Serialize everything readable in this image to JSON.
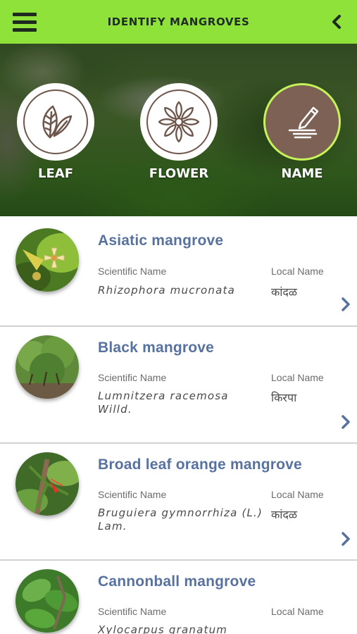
{
  "header": {
    "title": "IDENTIFY MANGROVES",
    "menu_icon": "hamburger-menu-icon",
    "back_icon": "chevron-left-icon",
    "bar_color": "#8ee23a"
  },
  "categories": [
    {
      "label": "LEAF",
      "icon": "leaf-icon",
      "active": false
    },
    {
      "label": "FLOWER",
      "icon": "flower-icon",
      "active": false
    },
    {
      "label": "NAME",
      "icon": "pencil-write-icon",
      "active": true
    }
  ],
  "list": {
    "scientific_label": "Scientific Name",
    "local_label": "Local Name",
    "items": [
      {
        "common_name": "Asiatic mangrove",
        "scientific_name": "Rhizophora mucronata",
        "local_name": "कांदळ"
      },
      {
        "common_name": "Black mangrove",
        "scientific_name": "Lumnitzera racemosa Willd.",
        "local_name": "किरपा"
      },
      {
        "common_name": "Broad leaf orange mangrove",
        "scientific_name": "Bruguiera gymnorrhiza (L.) Lam.",
        "local_name": "कांदळ"
      },
      {
        "common_name": "Cannonball mangrove",
        "scientific_name": "Xylocarpus granatum",
        "local_name": ""
      }
    ]
  },
  "colors": {
    "accent_text": "#5872a0",
    "active_circle": "#7d6155",
    "active_ring": "#c6f25a"
  }
}
